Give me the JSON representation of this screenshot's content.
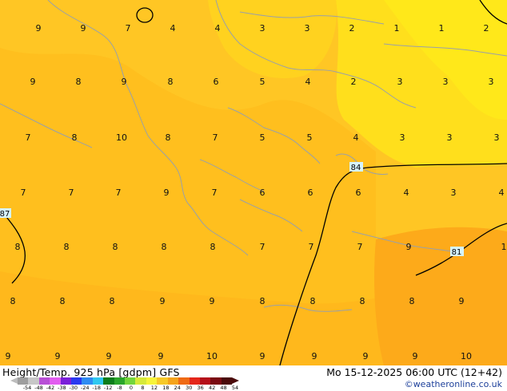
{
  "footer": {
    "title": "Height/Temp. 925 hPa [gdpm] GFS",
    "datetime": "Mo 15-12-2025 06:00 UTC (12+42)",
    "credit": "©weatheronline.co.uk"
  },
  "colorbar": {
    "ticks": [
      "-54",
      "-48",
      "-42",
      "-38",
      "-30",
      "-24",
      "-18",
      "-12",
      "-8",
      "0",
      "8",
      "12",
      "18",
      "24",
      "30",
      "36",
      "42",
      "48",
      "54"
    ],
    "colors": [
      "#9e9e9e",
      "#c7c7c7",
      "#b84fd6",
      "#e25cf0",
      "#7a1fd9",
      "#2a39f0",
      "#2f8cf2",
      "#30c8f0",
      "#0b7d1b",
      "#2aa52a",
      "#73d53c",
      "#d6ea3a",
      "#f7f43a",
      "#f7c928",
      "#f5a31b",
      "#ef6a15",
      "#e4261a",
      "#b5101a",
      "#7a0a12",
      "#4a0a0a"
    ]
  },
  "map": {
    "contour_labels": [
      "84",
      "87",
      "81"
    ],
    "temperature_values": [
      "9",
      "9",
      "7",
      "4",
      "4",
      "3",
      "3",
      "2",
      "1",
      "1",
      "2",
      "9",
      "8",
      "9",
      "8",
      "6",
      "5",
      "4",
      "2",
      "3",
      "3",
      "3",
      "7",
      "8",
      "10",
      "8",
      "7",
      "5",
      "5",
      "4",
      "3",
      "3",
      "3",
      "7",
      "7",
      "7",
      "9",
      "7",
      "6",
      "6",
      "6",
      "4",
      "3",
      "4",
      "8",
      "8",
      "8",
      "8",
      "8",
      "7",
      "7",
      "7",
      "9",
      "1",
      "8",
      "8",
      "8",
      "9",
      "9",
      "8",
      "8",
      "8",
      "8",
      "9",
      "9",
      "9",
      "9",
      "9",
      "10",
      "9",
      "9",
      "9",
      "9",
      "10"
    ]
  }
}
